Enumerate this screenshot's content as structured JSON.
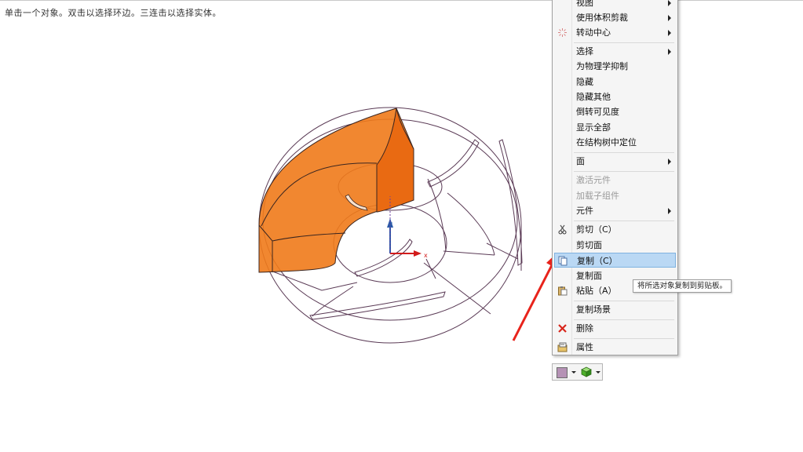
{
  "status_hint": "单击一个对象。双击以选择环边。三连击以选择实体。",
  "axes": {
    "z": "z",
    "x": "x"
  },
  "context_menu": {
    "items": [
      {
        "label": "视图",
        "submenu": true
      },
      {
        "label": "使用体积剪裁",
        "submenu": true
      },
      {
        "label": "转动中心",
        "submenu": true,
        "icon": "rotation-center-icon"
      },
      {
        "label": "选择",
        "submenu": true
      },
      {
        "label": "为物理学抑制"
      },
      {
        "label": "隐藏"
      },
      {
        "label": "隐藏其他"
      },
      {
        "label": "倒转可见度"
      },
      {
        "label": "显示全部"
      },
      {
        "label": "在结构树中定位"
      },
      {
        "label": "面",
        "submenu": true
      },
      {
        "label": "激活元件",
        "disabled": true
      },
      {
        "label": "加载子组件",
        "disabled": true
      },
      {
        "label": "元件",
        "submenu": true
      },
      {
        "label": "剪切（C）",
        "icon": "scissors-icon"
      },
      {
        "label": "剪切面"
      },
      {
        "label": "复制（C）",
        "icon": "copy-icon",
        "highlighted": true
      },
      {
        "label": "复制面"
      },
      {
        "label": "粘贴（A）",
        "icon": "paste-icon"
      },
      {
        "label": "复制场景"
      },
      {
        "label": "删除",
        "icon": "delete-icon"
      },
      {
        "label": "属性",
        "icon": "properties-icon"
      }
    ]
  },
  "tooltip": "将所选对象复制到剪贴板。",
  "mini_toolbar": {
    "color_swatch": "#b592b5",
    "body_icon": "green-cube-icon"
  },
  "colors": {
    "selection_orange": "#f07a1a",
    "wireframe": "#5a3a55",
    "highlight": "#bad8f4",
    "arrow": "#e8231b"
  }
}
